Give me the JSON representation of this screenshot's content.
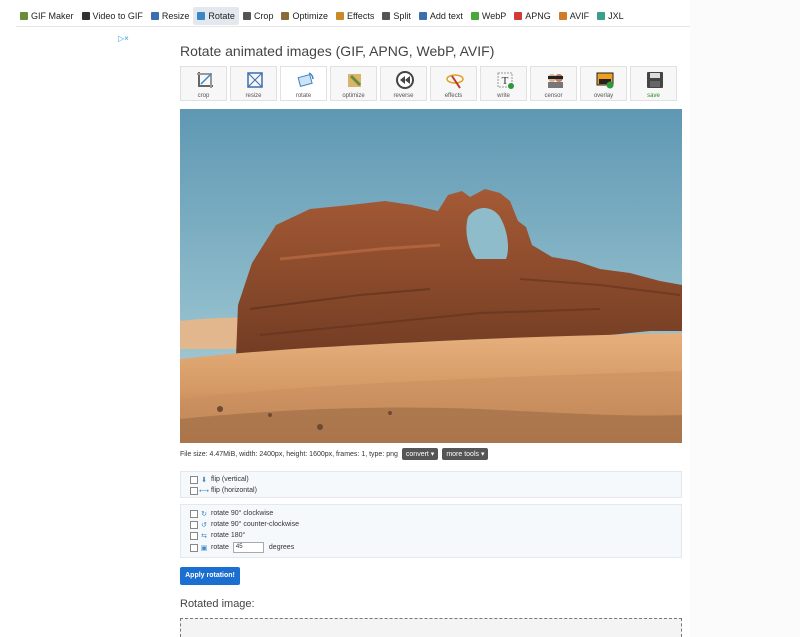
{
  "nav": {
    "items": [
      {
        "label": "GIF Maker",
        "icon": "gif-maker-icon",
        "color": "#6a8c3a"
      },
      {
        "label": "Video to GIF",
        "icon": "video-icon",
        "color": "#333333"
      },
      {
        "label": "Resize",
        "icon": "resize-icon",
        "color": "#3a6fb0"
      },
      {
        "label": "Rotate",
        "icon": "rotate-icon",
        "color": "#3a86c9"
      },
      {
        "label": "Crop",
        "icon": "crop-icon",
        "color": "#555555"
      },
      {
        "label": "Optimize",
        "icon": "optimize-icon",
        "color": "#8a6a3a"
      },
      {
        "label": "Effects",
        "icon": "effects-icon",
        "color": "#c98a2a"
      },
      {
        "label": "Split",
        "icon": "split-icon",
        "color": "#555555"
      },
      {
        "label": "Add text",
        "icon": "text-icon",
        "color": "#3a6fb0"
      },
      {
        "label": "WebP",
        "icon": "webp-icon",
        "color": "#4aa83a"
      },
      {
        "label": "APNG",
        "icon": "apng-icon",
        "color": "#d03a3a"
      },
      {
        "label": "AVIF",
        "icon": "avif-icon",
        "color": "#d07a2a"
      },
      {
        "label": "JXL",
        "icon": "jxl-icon",
        "color": "#3aa08a"
      }
    ],
    "active_index": 3
  },
  "ad": {
    "mark": "▷×"
  },
  "page": {
    "title": "Rotate animated images (GIF, APNG, WebP, AVIF)"
  },
  "toolbar": {
    "tools": [
      {
        "label": "crop",
        "icon": "crop-tool-icon"
      },
      {
        "label": "resize",
        "icon": "resize-tool-icon"
      },
      {
        "label": "rotate",
        "icon": "rotate-tool-icon"
      },
      {
        "label": "optimize",
        "icon": "optimize-tool-icon"
      },
      {
        "label": "reverse",
        "icon": "reverse-tool-icon"
      },
      {
        "label": "effects",
        "icon": "effects-tool-icon"
      },
      {
        "label": "write",
        "icon": "write-tool-icon"
      },
      {
        "label": "censor",
        "icon": "censor-tool-icon"
      },
      {
        "label": "overlay",
        "icon": "overlay-tool-icon"
      },
      {
        "label": "save",
        "icon": "save-tool-icon"
      }
    ]
  },
  "file_info": {
    "text": "File size: 4.47MiB, width: 2400px, height: 1600px, frames: 1, type: png",
    "convert_label": "convert ▾",
    "more_tools_label": "more tools ▾"
  },
  "flip": {
    "vertical_label": "flip (vertical)",
    "horizontal_label": "flip (horizontal)"
  },
  "rotate": {
    "cw_label": "rotate 90° clockwise",
    "ccw_label": "rotate 90° counter-clockwise",
    "r180_label": "rotate 180°",
    "custom_label": "rotate",
    "degrees_value": "45",
    "degrees_unit": "degrees"
  },
  "apply": {
    "label": "Apply rotation!"
  },
  "result": {
    "title": "Rotated image:"
  }
}
